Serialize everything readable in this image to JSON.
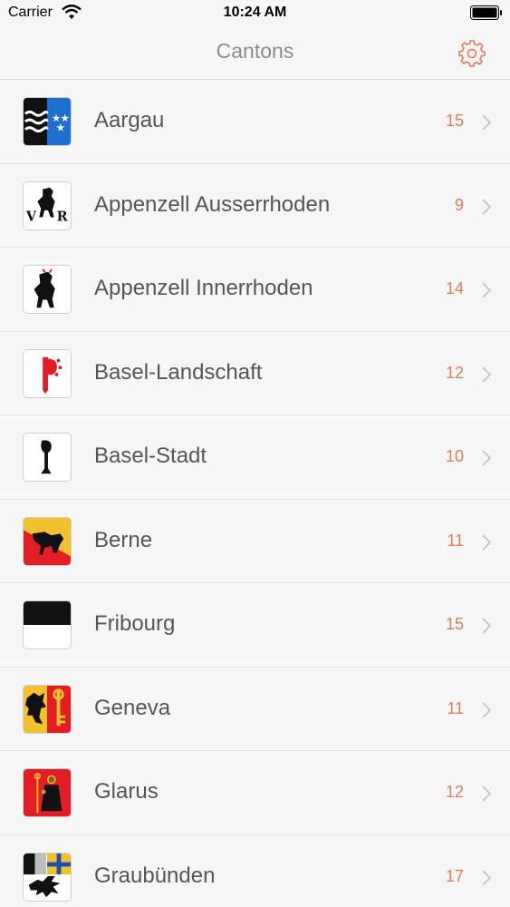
{
  "status_bar": {
    "carrier": "Carrier",
    "time": "10:24 AM"
  },
  "nav": {
    "title": "Cantons"
  },
  "colors": {
    "accent": "#e27b5e",
    "background": "#f7f7f7",
    "text": "#555555"
  },
  "cantons": [
    {
      "name": "Aargau",
      "count": "15",
      "icon": "aargau-flag-icon"
    },
    {
      "name": "Appenzell Ausserrhoden",
      "count": "9",
      "icon": "appenzell-ausserrhoden-flag-icon"
    },
    {
      "name": "Appenzell Innerrhoden",
      "count": "14",
      "icon": "appenzell-innerrhoden-flag-icon"
    },
    {
      "name": "Basel-Landschaft",
      "count": "12",
      "icon": "basel-landschaft-flag-icon"
    },
    {
      "name": "Basel-Stadt",
      "count": "10",
      "icon": "basel-stadt-flag-icon"
    },
    {
      "name": "Berne",
      "count": "11",
      "icon": "berne-flag-icon"
    },
    {
      "name": "Fribourg",
      "count": "15",
      "icon": "fribourg-flag-icon"
    },
    {
      "name": "Geneva",
      "count": "11",
      "icon": "geneva-flag-icon"
    },
    {
      "name": "Glarus",
      "count": "12",
      "icon": "glarus-flag-icon"
    },
    {
      "name": "Graubünden",
      "count": "17",
      "icon": "graubuenden-flag-icon"
    }
  ]
}
